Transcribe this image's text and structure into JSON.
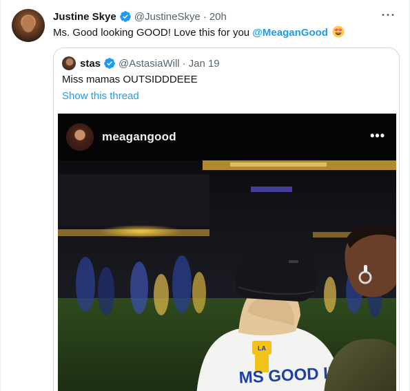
{
  "tweet": {
    "author_name": "Justine Skye",
    "author_handle": "@JustineSkye",
    "separator": "·",
    "time": "20h",
    "text_prefix": "Ms. Good looking GOOD! Love this for you ",
    "mention": "@MeaganGood",
    "emoji_icon": "smiling-face-with-heart-eyes-emoji",
    "more_icon": "more-horizontal-icon"
  },
  "quote": {
    "author_name": "stas",
    "author_handle": "@AstasiaWill",
    "separator": "·",
    "date": "Jan 19",
    "text": "Miss mamas OUTSIDDDEEE",
    "thread_link": "Show this thread"
  },
  "media": {
    "ig_username": "meagangood",
    "ig_more_icon": "more-horizontal-icon",
    "shirt_text": "MS GOOD IF",
    "cap_patch_text": "LA"
  },
  "colors": {
    "accent": "#1d9bf0",
    "text": "#0f1419",
    "secondary": "#536471",
    "border": "#cfd9de"
  }
}
